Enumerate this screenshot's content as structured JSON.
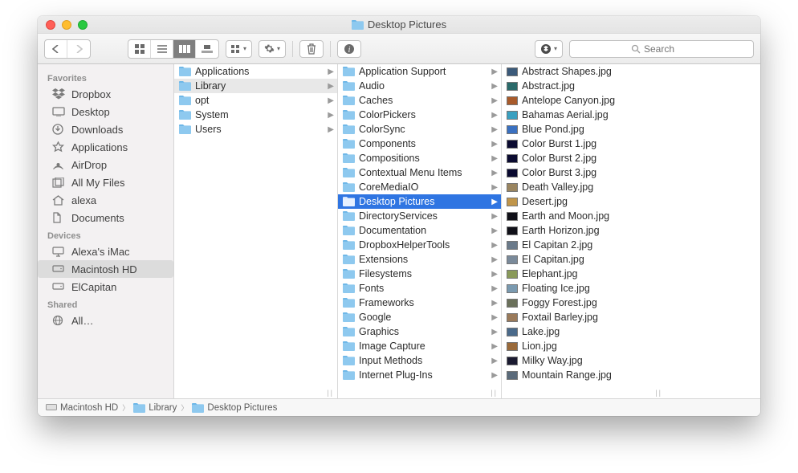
{
  "window": {
    "title": "Desktop Pictures"
  },
  "search": {
    "placeholder": "Search"
  },
  "sidebar": {
    "sections": [
      {
        "title": "Favorites",
        "items": [
          {
            "icon": "dropbox",
            "label": "Dropbox"
          },
          {
            "icon": "desktop",
            "label": "Desktop"
          },
          {
            "icon": "downloads",
            "label": "Downloads"
          },
          {
            "icon": "applications",
            "label": "Applications"
          },
          {
            "icon": "airdrop",
            "label": "AirDrop"
          },
          {
            "icon": "allfiles",
            "label": "All My Files"
          },
          {
            "icon": "home",
            "label": "alexa"
          },
          {
            "icon": "documents",
            "label": "Documents"
          }
        ]
      },
      {
        "title": "Devices",
        "items": [
          {
            "icon": "imac",
            "label": "Alexa's iMac"
          },
          {
            "icon": "hd",
            "label": "Macintosh HD",
            "selected": true
          },
          {
            "icon": "hd",
            "label": "ElCapitan"
          }
        ]
      },
      {
        "title": "Shared",
        "items": [
          {
            "icon": "globe",
            "label": "All…"
          }
        ]
      }
    ]
  },
  "columns": [
    {
      "items": [
        {
          "type": "folder",
          "label": "Applications",
          "arrow": true
        },
        {
          "type": "folder",
          "label": "Library",
          "arrow": true,
          "selected": "dim"
        },
        {
          "type": "folder",
          "label": "opt",
          "arrow": true
        },
        {
          "type": "folder",
          "label": "System",
          "arrow": true
        },
        {
          "type": "folder",
          "label": "Users",
          "arrow": true
        }
      ]
    },
    {
      "items": [
        {
          "type": "folder",
          "label": "Application Support",
          "arrow": true
        },
        {
          "type": "folder",
          "label": "Audio",
          "arrow": true
        },
        {
          "type": "folder",
          "label": "Caches",
          "arrow": true
        },
        {
          "type": "folder",
          "label": "ColorPickers",
          "arrow": true
        },
        {
          "type": "folder",
          "label": "ColorSync",
          "arrow": true
        },
        {
          "type": "folder",
          "label": "Components",
          "arrow": true
        },
        {
          "type": "folder",
          "label": "Compositions",
          "arrow": true
        },
        {
          "type": "folder",
          "label": "Contextual Menu Items",
          "arrow": true
        },
        {
          "type": "folder",
          "label": "CoreMediaIO",
          "arrow": true
        },
        {
          "type": "folder",
          "label": "Desktop Pictures",
          "arrow": true,
          "selected": "active"
        },
        {
          "type": "folder",
          "label": "DirectoryServices",
          "arrow": true
        },
        {
          "type": "folder",
          "label": "Documentation",
          "arrow": true
        },
        {
          "type": "folder",
          "label": "DropboxHelperTools",
          "arrow": true
        },
        {
          "type": "folder",
          "label": "Extensions",
          "arrow": true
        },
        {
          "type": "folder",
          "label": "Filesystems",
          "arrow": true
        },
        {
          "type": "folder",
          "label": "Fonts",
          "arrow": true
        },
        {
          "type": "folder",
          "label": "Frameworks",
          "arrow": true
        },
        {
          "type": "folder",
          "label": "Google",
          "arrow": true
        },
        {
          "type": "folder",
          "label": "Graphics",
          "arrow": true
        },
        {
          "type": "folder",
          "label": "Image Capture",
          "arrow": true
        },
        {
          "type": "folder",
          "label": "Input Methods",
          "arrow": true
        },
        {
          "type": "folder",
          "label": "Internet Plug-Ins",
          "arrow": true
        }
      ]
    },
    {
      "items": [
        {
          "type": "img",
          "label": "Abstract Shapes.jpg",
          "color": "#3b5a7a"
        },
        {
          "type": "img",
          "label": "Abstract.jpg",
          "color": "#2a6a6a"
        },
        {
          "type": "img",
          "label": "Antelope Canyon.jpg",
          "color": "#a85a2a"
        },
        {
          "type": "img",
          "label": "Bahamas Aerial.jpg",
          "color": "#3aa0c0"
        },
        {
          "type": "img",
          "label": "Blue Pond.jpg",
          "color": "#3a70c0"
        },
        {
          "type": "img",
          "label": "Color Burst 1.jpg",
          "color": "#0a0a30"
        },
        {
          "type": "img",
          "label": "Color Burst 2.jpg",
          "color": "#0a0a30"
        },
        {
          "type": "img",
          "label": "Color Burst 3.jpg",
          "color": "#0a0a30"
        },
        {
          "type": "img",
          "label": "Death Valley.jpg",
          "color": "#9a8560"
        },
        {
          "type": "img",
          "label": "Desert.jpg",
          "color": "#c0954a"
        },
        {
          "type": "img",
          "label": "Earth and Moon.jpg",
          "color": "#101018"
        },
        {
          "type": "img",
          "label": "Earth Horizon.jpg",
          "color": "#101018"
        },
        {
          "type": "img",
          "label": "El Capitan 2.jpg",
          "color": "#6a7a8a"
        },
        {
          "type": "img",
          "label": "El Capitan.jpg",
          "color": "#7a8a9a"
        },
        {
          "type": "img",
          "label": "Elephant.jpg",
          "color": "#8a9a5a"
        },
        {
          "type": "img",
          "label": "Floating Ice.jpg",
          "color": "#7a9ab0"
        },
        {
          "type": "img",
          "label": "Foggy Forest.jpg",
          "color": "#6a705a"
        },
        {
          "type": "img",
          "label": "Foxtail Barley.jpg",
          "color": "#9a7a5a"
        },
        {
          "type": "img",
          "label": "Lake.jpg",
          "color": "#4a6a8a"
        },
        {
          "type": "img",
          "label": "Lion.jpg",
          "color": "#9a6a3a"
        },
        {
          "type": "img",
          "label": "Milky Way.jpg",
          "color": "#1a1a30"
        },
        {
          "type": "img",
          "label": "Mountain Range.jpg",
          "color": "#5a6a7a"
        }
      ]
    }
  ],
  "path": [
    {
      "icon": "hd",
      "label": "Macintosh HD"
    },
    {
      "icon": "folder",
      "label": "Library"
    },
    {
      "icon": "folder",
      "label": "Desktop Pictures"
    }
  ]
}
